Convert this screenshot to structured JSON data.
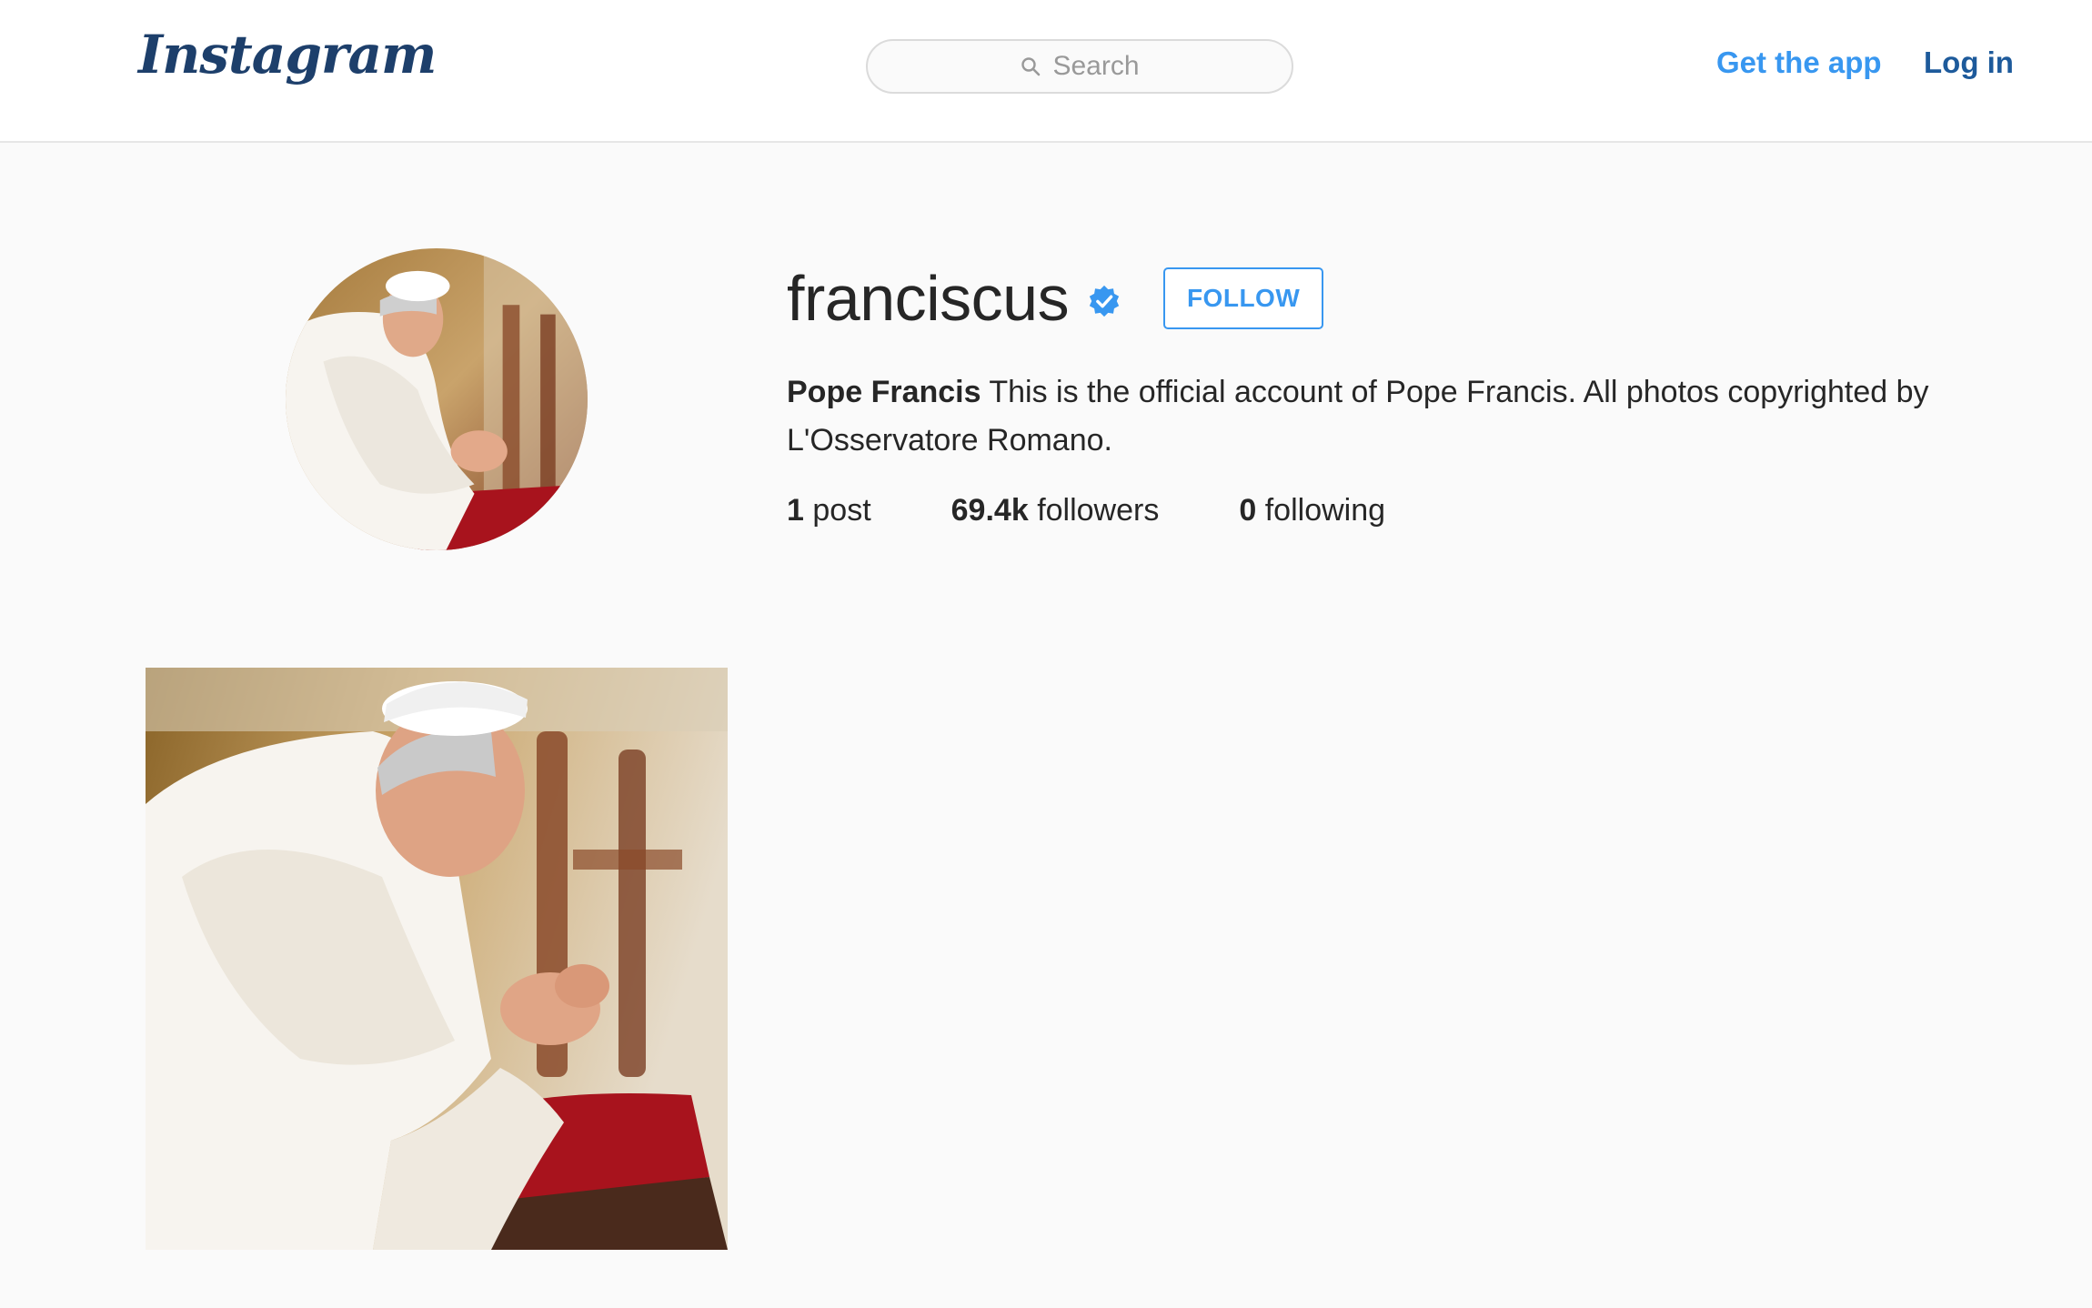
{
  "header": {
    "logo_text": "Instagram",
    "search_placeholder": "Search",
    "get_app_label": "Get the app",
    "login_label": "Log in"
  },
  "profile": {
    "username": "franciscus",
    "verified": true,
    "follow_label": "FOLLOW",
    "bio_name": "Pope Francis",
    "bio_text": "This is the official account of Pope Francis. All photos copyrighted by L'Osservatore Romano.",
    "stats": {
      "posts_count": "1",
      "posts_label": "post",
      "followers_count": "69.4k",
      "followers_label": "followers",
      "following_count": "0",
      "following_label": "following"
    }
  },
  "posts": [
    {
      "subject": "Pope Francis praying, kneeling at a red prie-dieu"
    }
  ],
  "colors": {
    "accent_blue": "#3897f0",
    "login_blue": "#1d5a9b",
    "logo_navy": "#1d3f6b",
    "background": "#fafafa"
  },
  "icons": {
    "search": "search-icon",
    "verified": "verified-badge-icon"
  }
}
